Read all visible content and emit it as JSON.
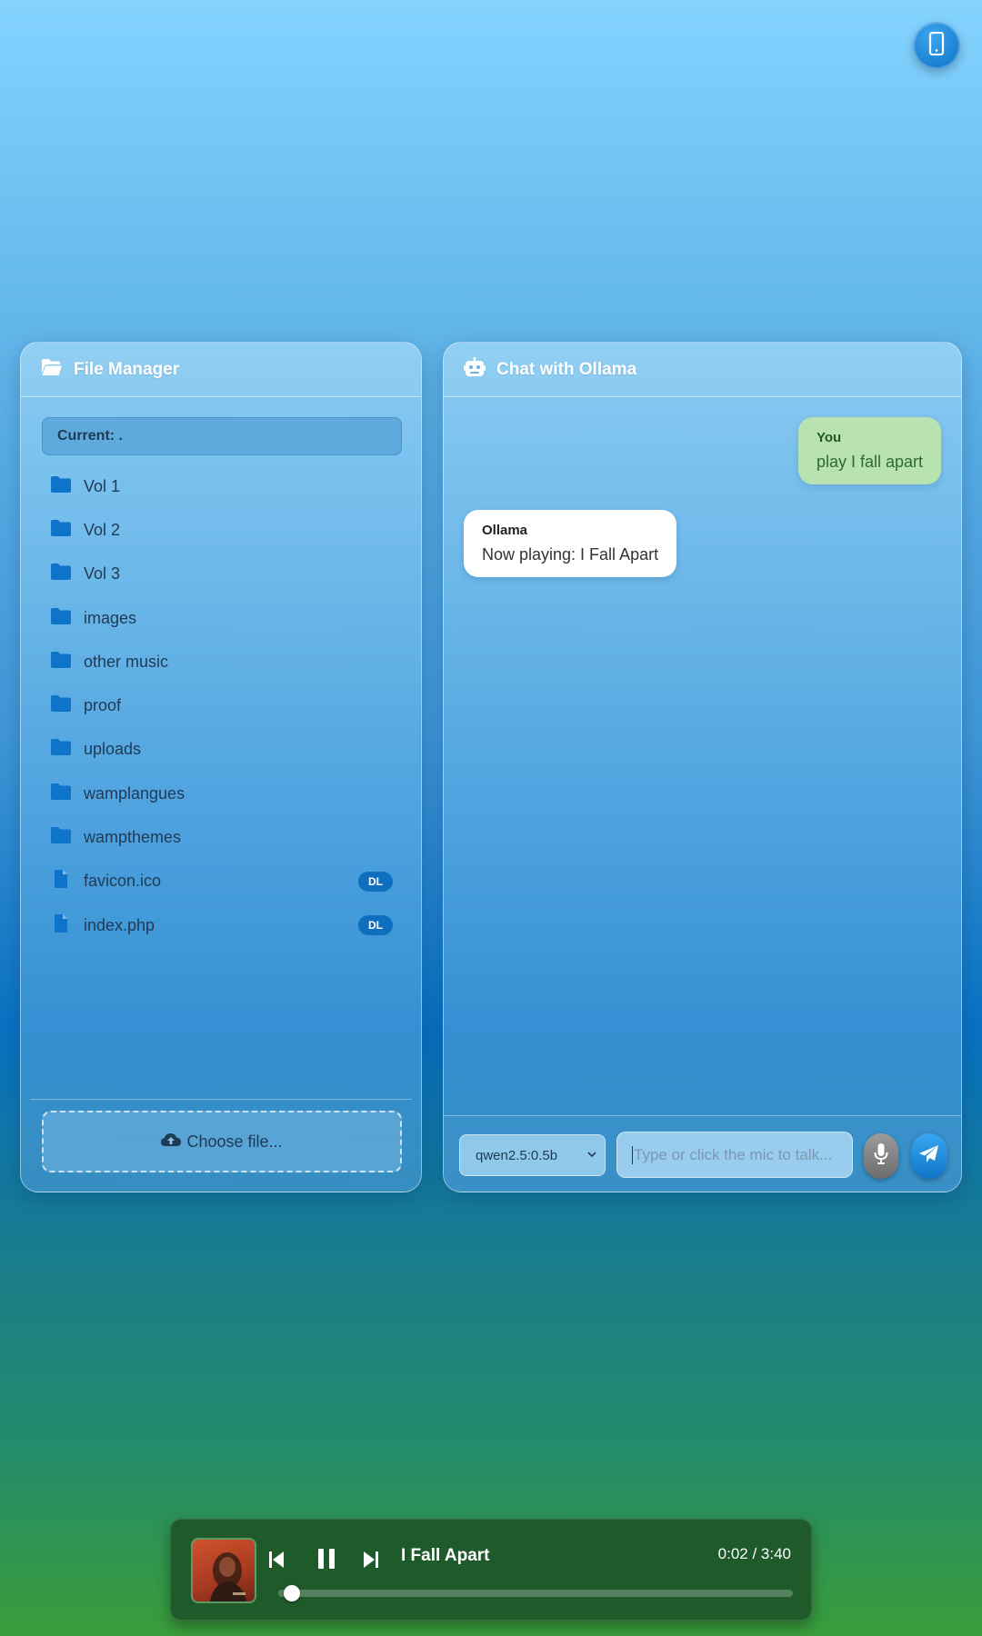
{
  "colors": {
    "accent": "#0d6fbd",
    "user_bubble": "#b8e3b0",
    "player_bg": "#1e5a2a"
  },
  "top_button": {
    "icon": "mobile-phone-icon"
  },
  "file_manager": {
    "title": "File Manager",
    "icon": "folder-open-icon",
    "current_path": "Current: .",
    "items": [
      {
        "name": "Vol 1",
        "type": "folder"
      },
      {
        "name": "Vol 2",
        "type": "folder"
      },
      {
        "name": "Vol 3",
        "type": "folder"
      },
      {
        "name": "images",
        "type": "folder"
      },
      {
        "name": "other music",
        "type": "folder"
      },
      {
        "name": "proof",
        "type": "folder"
      },
      {
        "name": "uploads",
        "type": "folder"
      },
      {
        "name": "wamplangues",
        "type": "folder"
      },
      {
        "name": "wampthemes",
        "type": "folder"
      },
      {
        "name": "favicon.ico",
        "type": "file",
        "badge": "DL"
      },
      {
        "name": "index.php",
        "type": "file",
        "badge": "DL"
      }
    ],
    "upload_label": "Choose file...",
    "upload_icon": "cloud-upload-icon"
  },
  "chat": {
    "title": "Chat with Ollama",
    "icon": "robot-icon",
    "messages": [
      {
        "sender": "You",
        "text": "play I fall apart",
        "role": "user"
      },
      {
        "sender": "Ollama",
        "text": "Now playing: I Fall Apart",
        "role": "bot"
      }
    ],
    "model_selected": "qwen2.5:0.5b",
    "input_placeholder": "Type or click the mic to talk...",
    "input_value": "",
    "mic_icon": "microphone-icon",
    "send_icon": "paper-plane-icon"
  },
  "player": {
    "track_title": "I Fall Apart",
    "time": "0:02 / 3:40",
    "progress_fraction": 0.009,
    "prev_icon": "skip-previous-icon",
    "pause_icon": "pause-icon",
    "next_icon": "skip-next-icon"
  }
}
